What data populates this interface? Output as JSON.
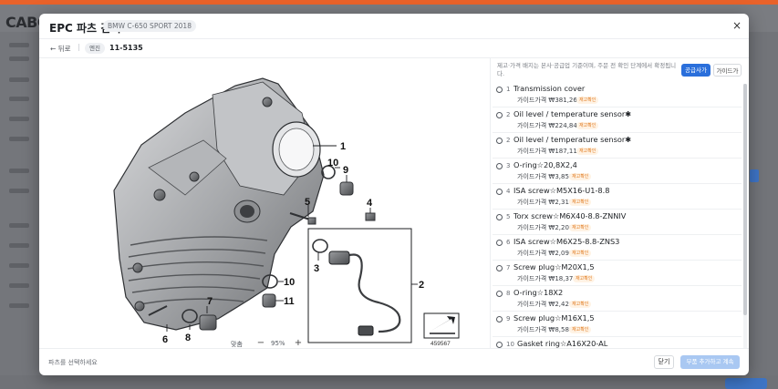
{
  "background": {
    "logo": "CABC",
    "accent_color": "#e9622a",
    "primary_color": "#2a6fdb"
  },
  "modal": {
    "title": "EPC 파츠 검색",
    "vehicle_badge": "BMW C-650 SPORT 2018",
    "close_icon": "×",
    "back_label": "← 뒤로",
    "separator": "|",
    "category_chip": "엔진",
    "part_code": "11-5135"
  },
  "diagram": {
    "image_id": "459567",
    "callouts": [
      "1",
      "2",
      "3",
      "4",
      "5",
      "6",
      "7",
      "8",
      "9",
      "10",
      "10",
      "11"
    ]
  },
  "zoom": {
    "label": "맞춤",
    "minus": "−",
    "value": "95%",
    "plus": "+"
  },
  "notice": "제고·가격 배지는 본사·공급업 기준이며, 주문 전 확인 단계에서 확정됩니다.",
  "price_toggle": {
    "supply_label": "공급사가",
    "guide_label": "가이드가"
  },
  "parts": [
    {
      "no": "1",
      "name": "Transmission cover",
      "price": "가이드가격 ₩381,260",
      "tag": "재고확인"
    },
    {
      "no": "2",
      "name": "Oil level / temperature sensor✱",
      "price": "가이드가격 ₩224,840",
      "tag": "재고확인"
    },
    {
      "no": "2",
      "name": "Oil level / temperature sensor✱",
      "price": "가이드가격 ₩187,110",
      "tag": "재고확인"
    },
    {
      "no": "3",
      "name": "O-ring☆20,8X2,4",
      "price": "가이드가격 ₩3,850",
      "tag": "재고확인"
    },
    {
      "no": "4",
      "name": "ISA screw☆M5X16-U1-8.8",
      "price": "가이드가격 ₩2,310",
      "tag": "재고확인"
    },
    {
      "no": "5",
      "name": "Torx screw☆M6X40-8.8-ZNNIV",
      "price": "가이드가격 ₩2,200",
      "tag": "재고확인"
    },
    {
      "no": "6",
      "name": "ISA screw☆M6X25-8.8-ZNS3",
      "price": "가이드가격 ₩2,090",
      "tag": "재고확인"
    },
    {
      "no": "7",
      "name": "Screw plug☆M20X1,5",
      "price": "가이드가격 ₩18,370",
      "tag": "재고확인"
    },
    {
      "no": "8",
      "name": "O-ring☆18X2",
      "price": "가이드가격 ₩2,420",
      "tag": "재고확인"
    },
    {
      "no": "9",
      "name": "Screw plug☆M16X1,5",
      "price": "가이드가격 ₩8,580",
      "tag": "재고확인"
    },
    {
      "no": "10",
      "name": "Gasket ring☆A16X20-AL",
      "price": "",
      "tag": ""
    }
  ],
  "footer": {
    "hint": "파츠를 선택하세요",
    "close_label": "닫기",
    "add_label": "부품 추가하고 계속"
  }
}
